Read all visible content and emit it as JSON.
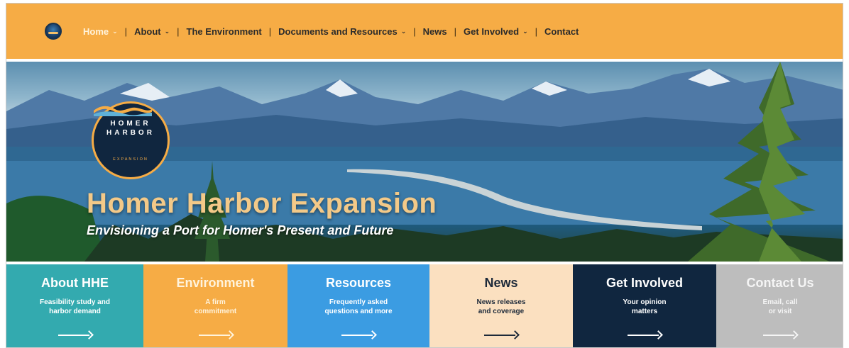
{
  "nav": {
    "items": [
      {
        "label": "Home",
        "has_dropdown": true,
        "active": true
      },
      {
        "label": "About",
        "has_dropdown": true
      },
      {
        "label": "The Environment",
        "has_dropdown": false
      },
      {
        "label": "Documents and Resources",
        "has_dropdown": true
      },
      {
        "label": "News",
        "has_dropdown": false
      },
      {
        "label": "Get Involved",
        "has_dropdown": true
      },
      {
        "label": "Contact",
        "has_dropdown": false
      }
    ],
    "separator": "|",
    "dropdown_icon": "chevron-down-icon",
    "background": "#f6ac45"
  },
  "hero": {
    "badge": {
      "line1": "HOMER",
      "line2": "HARBOR",
      "line3": "EXPANSION"
    },
    "title": "Homer Harbor Expansion",
    "subtitle": "Envisioning a Port for Homer's Present and Future"
  },
  "tiles": [
    {
      "title": "About HHE",
      "desc1": "Feasibility study and",
      "desc2": "harbor demand",
      "bg": "#33aaaf",
      "fg": "#ffffff"
    },
    {
      "title": "Environment",
      "desc1": "A firm",
      "desc2": "commitment",
      "bg": "#f6ac45",
      "fg": "#fff3dc"
    },
    {
      "title": "Resources",
      "desc1": "Frequently asked",
      "desc2": "questions and more",
      "bg": "#3b9ce2",
      "fg": "#ffffff"
    },
    {
      "title": "News",
      "desc1": "News releases",
      "desc2": "and coverage",
      "bg": "#fbe0c0",
      "fg": "#1d2a3a"
    },
    {
      "title": "Get Involved",
      "desc1": "Your opinion",
      "desc2": "matters",
      "bg": "#10263f",
      "fg": "#ffffff"
    },
    {
      "title": "Contact Us",
      "desc1": "Email, call",
      "desc2": "or visit",
      "bg": "#bdbdbd",
      "fg": "#f5f5f5"
    }
  ]
}
